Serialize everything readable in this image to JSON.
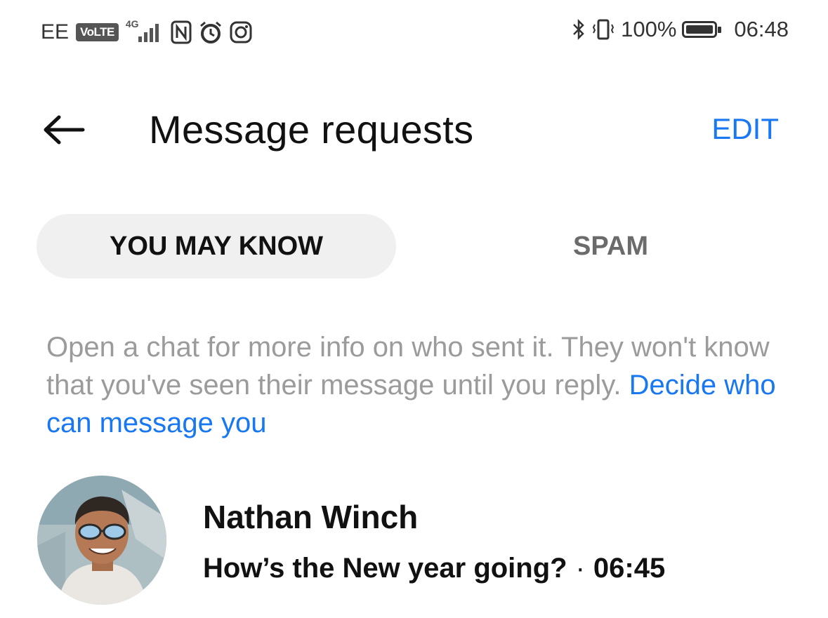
{
  "status_bar": {
    "carrier": "EE",
    "volte_label": "VoLTE",
    "network": "4G",
    "battery_percent": "100%",
    "time": "06:48",
    "icons": [
      "nfc-icon",
      "alarm-icon",
      "instagram-icon",
      "bluetooth-icon",
      "vibrate-icon",
      "battery-icon"
    ]
  },
  "header": {
    "title": "Message requests",
    "edit_label": "EDIT",
    "back_icon": "arrow-left-icon"
  },
  "tabs": [
    {
      "label": "YOU MAY KNOW",
      "active": true
    },
    {
      "label": "SPAM",
      "active": false
    }
  ],
  "info": {
    "text": "Open a chat for more info on who sent it. They won't know that you've seen their message until you reply. ",
    "link": "Decide who can message you"
  },
  "conversations": [
    {
      "name": "Nathan Winch",
      "message": "How’s the New year going?",
      "separator": "·",
      "time": "06:45"
    }
  ],
  "colors": {
    "accent": "#1877F2",
    "muted_text": "#9b9b9b",
    "tab_active_bg": "#f0f0f0",
    "tab_inactive_text": "#6b6b6b"
  }
}
